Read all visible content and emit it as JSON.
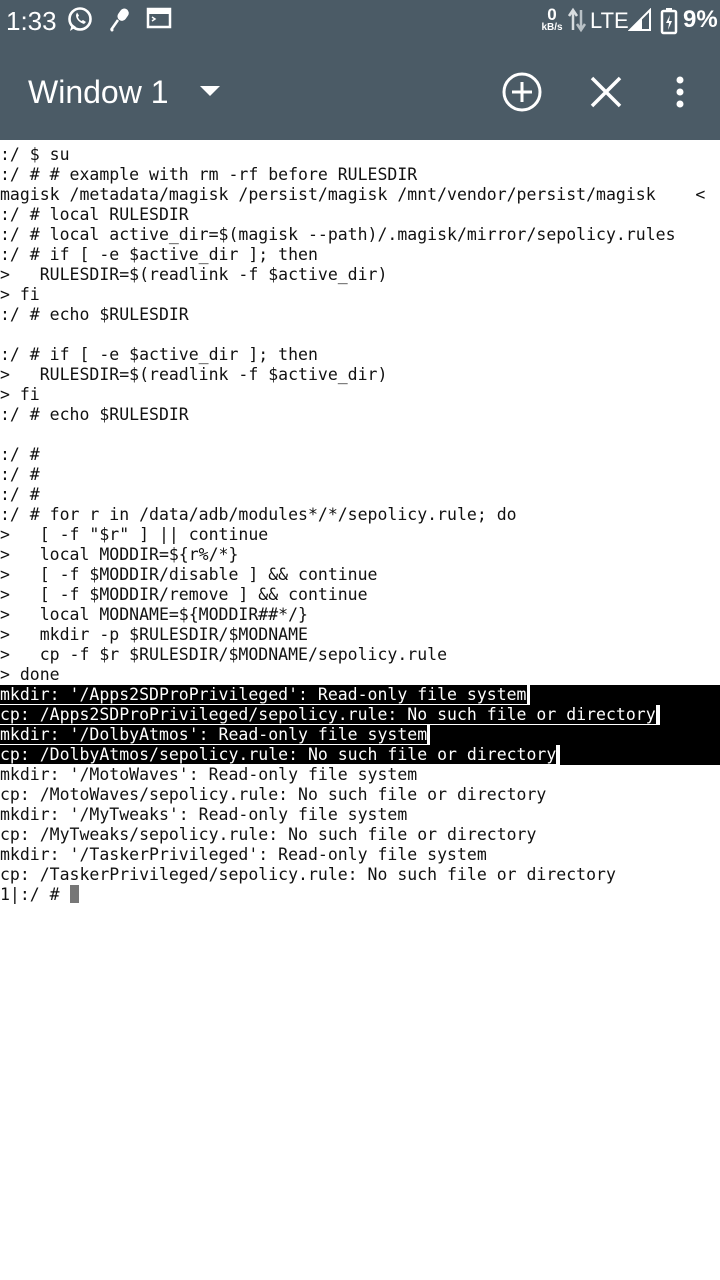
{
  "status_bar": {
    "time": "1:33",
    "net_speed_value": "0",
    "net_speed_unit": "kB/s",
    "network": "LTE",
    "battery": "9%",
    "icons": [
      "whatsapp-icon",
      "mic-icon",
      "terminal-icon",
      "data-arrows-icon",
      "signal-icon",
      "battery-icon"
    ]
  },
  "toolbar": {
    "title": "Window 1",
    "icons": [
      "dropdown-icon",
      "add-window-icon",
      "close-window-icon",
      "overflow-menu-icon"
    ]
  },
  "terminal": {
    "lines": [
      ":/ $ su",
      ":/ # # example with rm -rf before RULESDIR",
      "magisk /metadata/magisk /persist/magisk /mnt/vendor/persist/magisk    <",
      ":/ # local RULESDIR",
      ":/ # local active_dir=$(magisk --path)/.magisk/mirror/sepolicy.rules",
      ":/ # if [ -e $active_dir ]; then",
      ">   RULESDIR=$(readlink -f $active_dir)",
      "> fi",
      ":/ # echo $RULESDIR",
      "",
      ":/ # if [ -e $active_dir ]; then",
      ">   RULESDIR=$(readlink -f $active_dir)",
      "> fi",
      ":/ # echo $RULESDIR",
      "",
      ":/ #",
      ":/ #",
      ":/ #",
      ":/ # for r in /data/adb/modules*/*/sepolicy.rule; do",
      ">   [ -f \"$r\" ] || continue",
      ">   local MODDIR=${r%/*}",
      ">   [ -f $MODDIR/disable ] && continue",
      ">   [ -f $MODDIR/remove ] && continue",
      ">   local MODNAME=${MODDIR##*/}",
      ">   mkdir -p $RULESDIR/$MODNAME",
      ">   cp -f $r $RULESDIR/$MODNAME/sepolicy.rule",
      "> done",
      "mkdir: '/Apps2SDProPrivileged': Read-only file system",
      "cp: /Apps2SDProPrivileged/sepolicy.rule: No such file or directory",
      "mkdir: '/DolbyAtmos': Read-only file system",
      "cp: /DolbyAtmos/sepolicy.rule: No such file or directory",
      "mkdir: '/MotoWaves': Read-only file system",
      "cp: /MotoWaves/sepolicy.rule: No such file or directory",
      "mkdir: '/MyTweaks': Read-only file system",
      "cp: /MyTweaks/sepolicy.rule: No such file or directory",
      "mkdir: '/TaskerPrivileged': Read-only file system",
      "cp: /TaskerPrivileged/sepolicy.rule: No such file or directory",
      "1|:/ # "
    ]
  }
}
